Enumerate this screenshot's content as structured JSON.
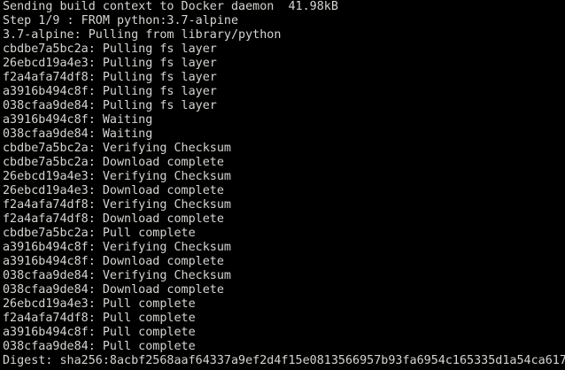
{
  "terminal": {
    "lines": [
      "Sending build context to Docker daemon  41.98kB",
      "Step 1/9 : FROM python:3.7-alpine",
      "3.7-alpine: Pulling from library/python",
      "cbdbe7a5bc2a: Pulling fs layer",
      "26ebcd19a4e3: Pulling fs layer",
      "f2a4afa74df8: Pulling fs layer",
      "a3916b494c8f: Pulling fs layer",
      "038cfaa9de84: Pulling fs layer",
      "a3916b494c8f: Waiting",
      "038cfaa9de84: Waiting",
      "cbdbe7a5bc2a: Verifying Checksum",
      "cbdbe7a5bc2a: Download complete",
      "26ebcd19a4e3: Verifying Checksum",
      "26ebcd19a4e3: Download complete",
      "f2a4afa74df8: Verifying Checksum",
      "f2a4afa74df8: Download complete",
      "cbdbe7a5bc2a: Pull complete",
      "a3916b494c8f: Verifying Checksum",
      "a3916b494c8f: Download complete",
      "038cfaa9de84: Verifying Checksum",
      "038cfaa9de84: Download complete",
      "26ebcd19a4e3: Pull complete",
      "f2a4afa74df8: Pull complete",
      "a3916b494c8f: Pull complete",
      "038cfaa9de84: Pull complete",
      "Digest: sha256:8acbf2568aaf64337a9ef2d4f15e0813566957b93fa6954c165335d1a54ca617"
    ]
  },
  "colors": {
    "background": "#000000",
    "foreground": "#d3d7cf"
  }
}
